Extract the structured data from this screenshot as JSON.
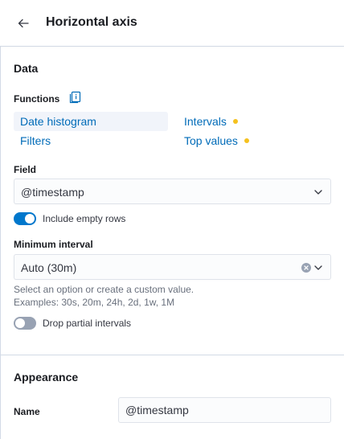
{
  "header": {
    "title": "Horizontal axis"
  },
  "data_section": {
    "title": "Data",
    "functions_label": "Functions",
    "functions": [
      {
        "label": "Date histogram",
        "selected": true,
        "has_dot": false
      },
      {
        "label": "Intervals",
        "selected": false,
        "has_dot": true
      },
      {
        "label": "Filters",
        "selected": false,
        "has_dot": false
      },
      {
        "label": "Top values",
        "selected": false,
        "has_dot": true
      }
    ],
    "field_label": "Field",
    "field_value": "@timestamp",
    "include_empty_rows": {
      "label": "Include empty rows",
      "on": true
    },
    "min_interval_label": "Minimum interval",
    "min_interval_value": "Auto (30m)",
    "help_line1": "Select an option or create a custom value.",
    "help_line2": "Examples: 30s, 20m, 24h, 2d, 1w, 1M",
    "drop_partial": {
      "label": "Drop partial intervals",
      "on": false
    }
  },
  "appearance_section": {
    "title": "Appearance",
    "name_label": "Name",
    "name_value": "@timestamp"
  },
  "colors": {
    "link": "#006bb8",
    "toggle_on": "#0077cc",
    "warning_dot": "#f5c11e",
    "border": "#d3dae6"
  },
  "icons": {
    "back": "arrow-left-icon",
    "docs": "documentation-icon",
    "chevron": "chevron-down-icon",
    "clear": "clear-icon"
  }
}
